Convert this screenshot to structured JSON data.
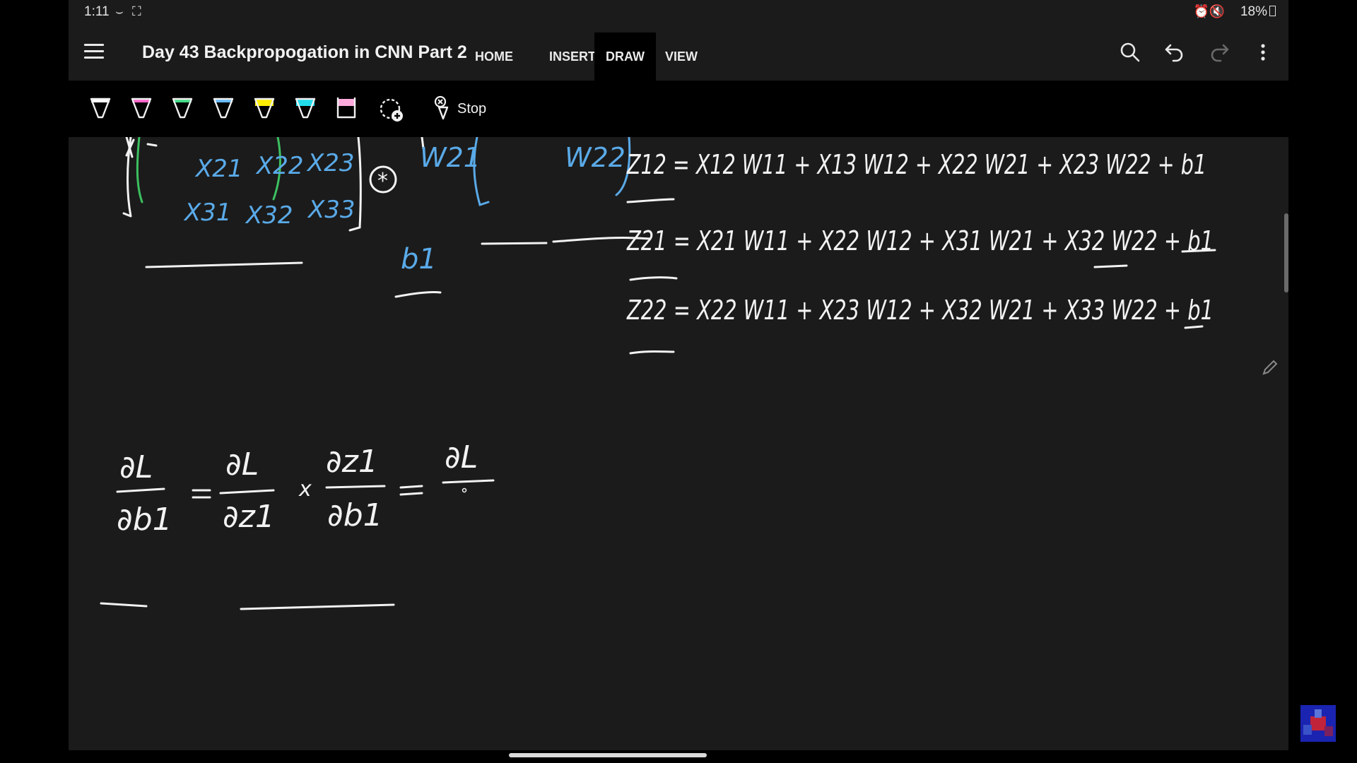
{
  "status": {
    "time": "1:11",
    "battery": "18%"
  },
  "header": {
    "title": "Day 43 Backpropogation in CNN Part 2",
    "tabs": [
      {
        "label": "HOME",
        "active": false
      },
      {
        "label": "INSERT",
        "active": false
      },
      {
        "label": "DRAW",
        "active": true
      },
      {
        "label": "VIEW",
        "active": false
      }
    ]
  },
  "toolbar": {
    "pens": [
      {
        "name": "white-pen",
        "color": "#ffffff"
      },
      {
        "name": "pink-pen",
        "color": "#ff66cc"
      },
      {
        "name": "green-pen",
        "color": "#44dd88"
      },
      {
        "name": "blue-pen",
        "color": "#66bbff"
      },
      {
        "name": "yellow-highlighter",
        "color": "#ffee00"
      },
      {
        "name": "cyan-highlighter",
        "color": "#22ddee"
      },
      {
        "name": "pink-highlighter",
        "color": "#ffaadd"
      }
    ],
    "stop_label": "Stop"
  },
  "colors": {
    "ink_white": "#f2f2f2",
    "ink_blue": "#5aaae8",
    "ink_green": "#3cc060"
  },
  "notes": {
    "matrix_x": {
      "r2c1": "X21",
      "r2c2": "X22",
      "r2c3": "X23",
      "r3c1": "X31",
      "r3c2": "X32",
      "r3c3": "X33"
    },
    "conv_op": "*",
    "kernel": {
      "w21": "W21",
      "w22": "W22"
    },
    "bias": "b1",
    "eq_z12": "Z12 = X12 W11 + X13 W12 + X22 W21 + X23 W22 + b1",
    "eq_z21": "Z21 = X21 W11 + X22 W12 + X31 W21 + X32 W22 + b1",
    "eq_z22": "Z22 = X22 W11 + X23 W12 + X32 W21 + X33 W22 + b1",
    "grad_lhs_num": "∂L",
    "grad_lhs_den": "∂b1",
    "grad_r1_num": "∂L",
    "grad_r1_den": "∂z1",
    "grad_times": "x",
    "grad_r2_num": "∂z1",
    "grad_r2_den": "∂b1",
    "grad_r3_num": "∂L"
  }
}
